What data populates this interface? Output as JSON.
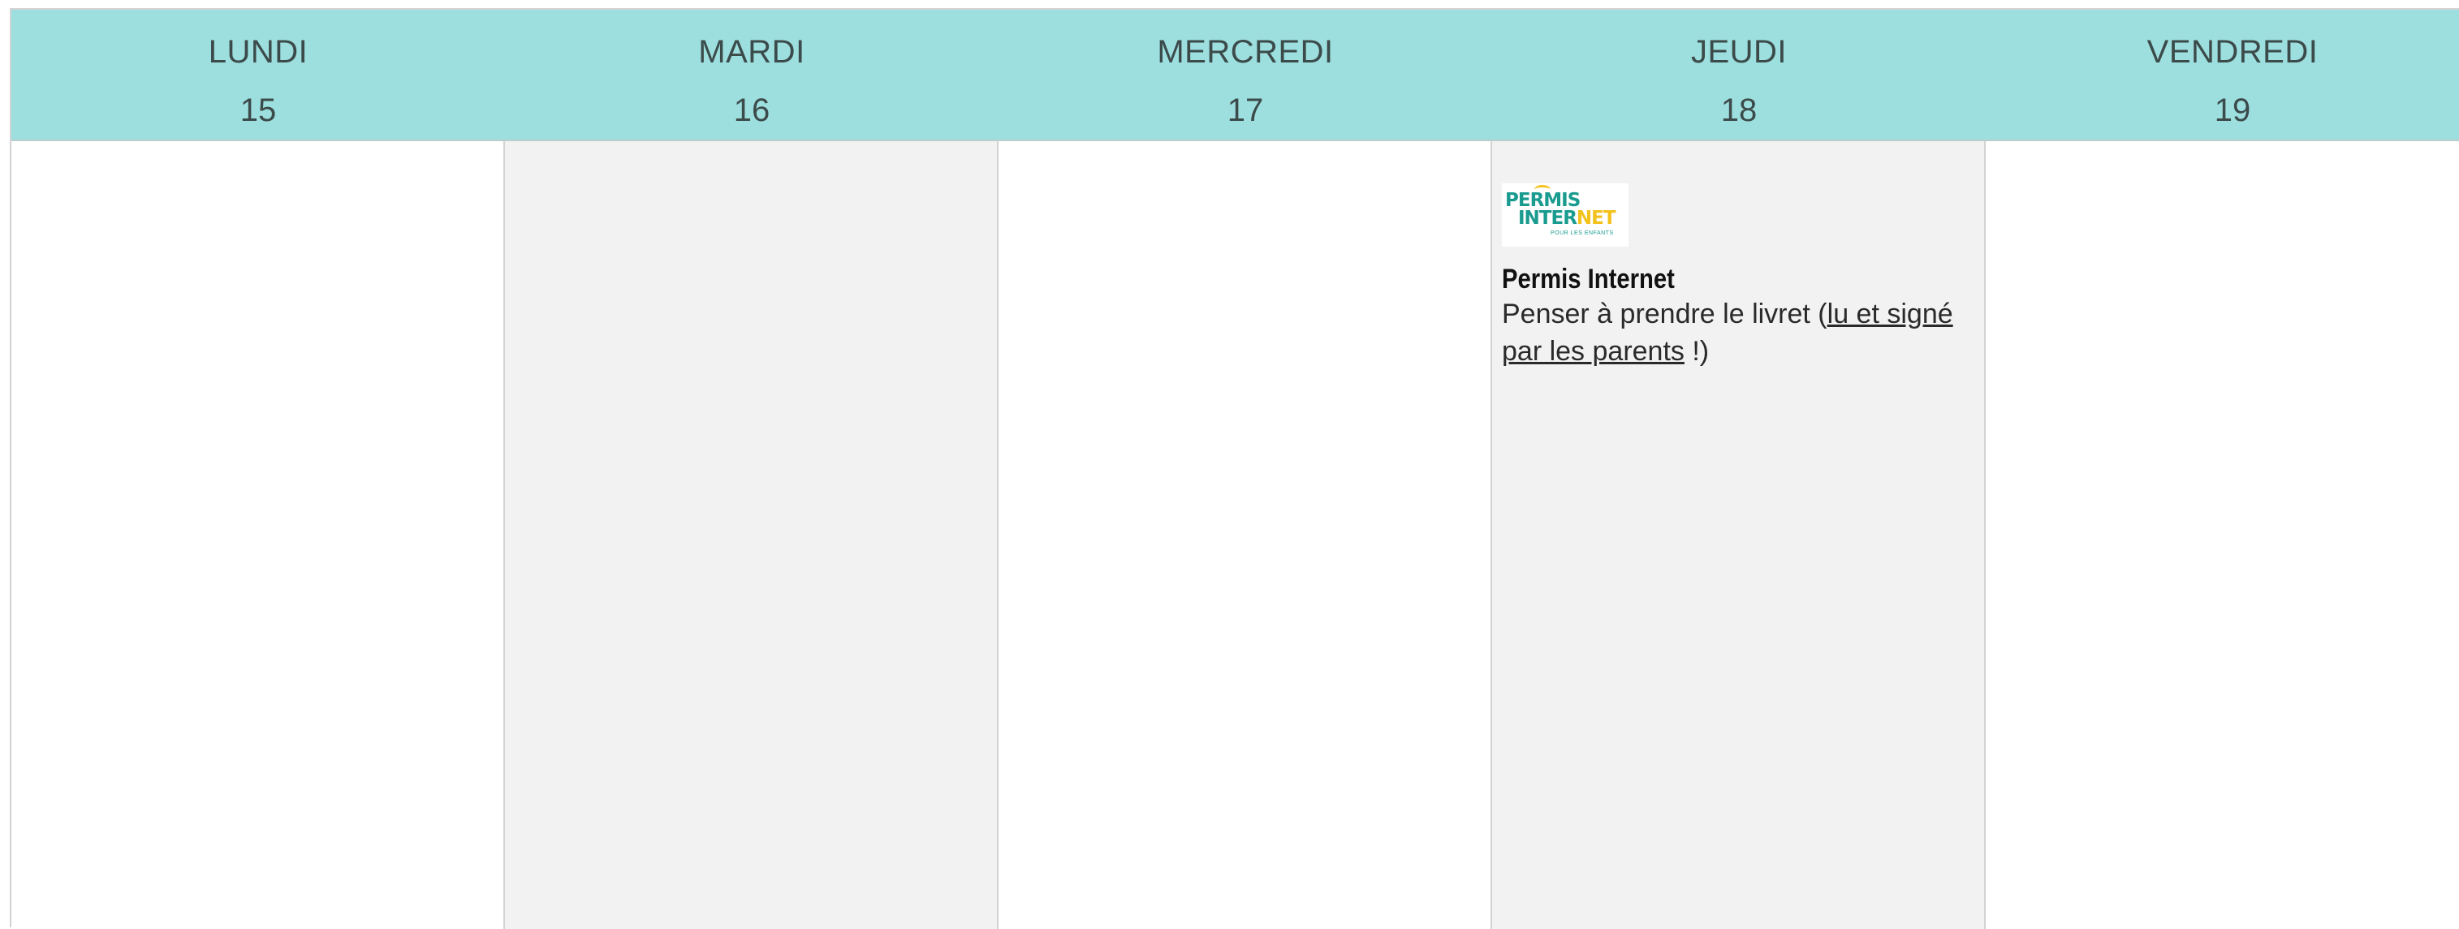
{
  "days": [
    {
      "name": "LUNDI",
      "number": "15"
    },
    {
      "name": "MARDI",
      "number": "16"
    },
    {
      "name": "MERCREDI",
      "number": "17"
    },
    {
      "name": "JEUDI",
      "number": "18"
    },
    {
      "name": "VENDREDI",
      "number": "19"
    }
  ],
  "event": {
    "logo": {
      "line1": "PERMIS",
      "line2a": "INTER",
      "line2b": "NET",
      "tagline": "POUR LES ENFANTS"
    },
    "title": "Permis Internet",
    "desc_before": "Penser à prendre le livret (",
    "desc_link": "lu et signé par les parents",
    "desc_after": " !)"
  },
  "colors": {
    "header_bg": "#9ddfdf",
    "shaded_col": "#f2f2f2",
    "logo_teal": "#1a9b8f",
    "logo_yellow": "#f3c21c"
  }
}
